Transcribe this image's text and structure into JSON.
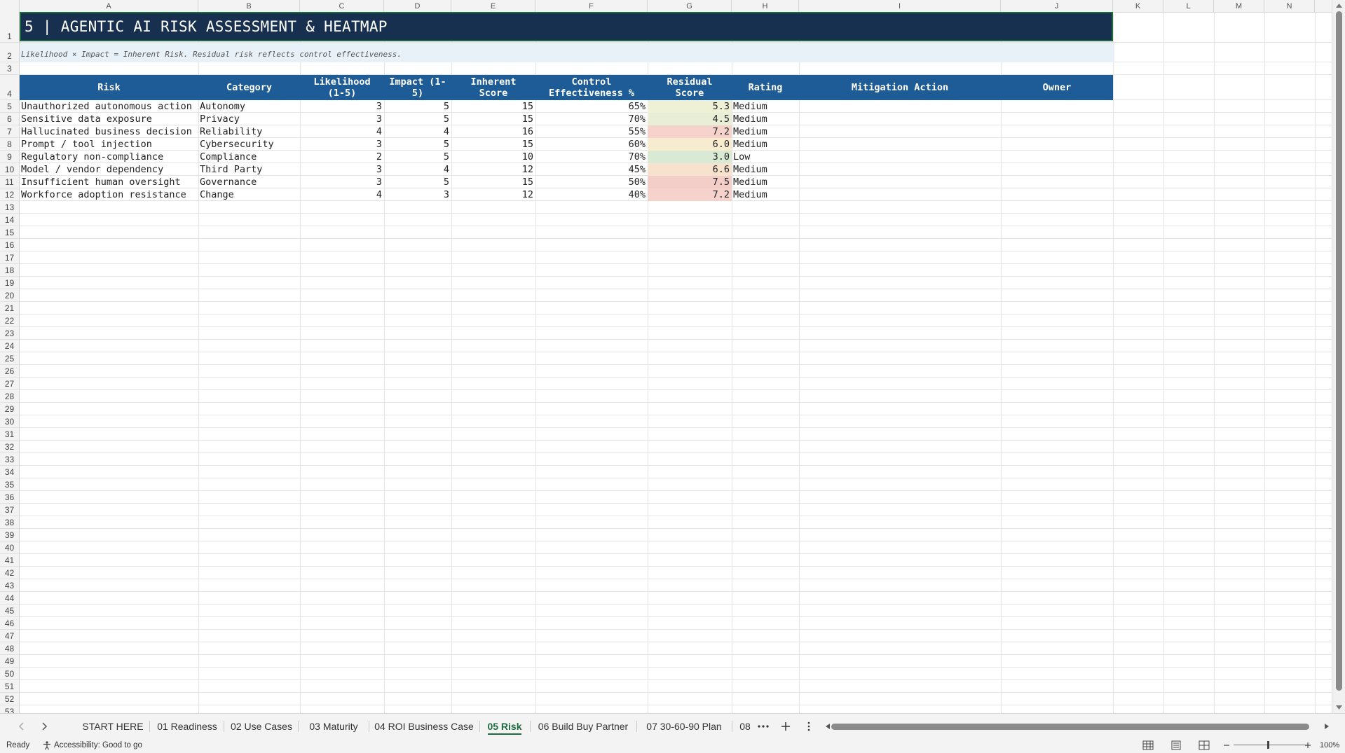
{
  "columns": [
    "A",
    "B",
    "C",
    "D",
    "E",
    "F",
    "G",
    "H",
    "I",
    "J",
    "K",
    "L",
    "M",
    "N"
  ],
  "row_numbers": [
    "1",
    "2",
    "3",
    "4",
    "5",
    "6",
    "7",
    "8",
    "9",
    "10",
    "11",
    "12",
    "13",
    "14",
    "15",
    "16",
    "17",
    "18",
    "19",
    "20",
    "21",
    "22",
    "23",
    "24",
    "25",
    "26",
    "27",
    "28",
    "29",
    "30",
    "31",
    "32",
    "33",
    "34",
    "35",
    "36",
    "37",
    "38",
    "39",
    "40",
    "41",
    "42",
    "43",
    "44",
    "45",
    "46",
    "47",
    "48",
    "49",
    "50",
    "51",
    "52",
    "53"
  ],
  "title": "5 | AGENTIC AI RISK ASSESSMENT & HEATMAP",
  "subtitle": "Likelihood × Impact = Inherent Risk. Residual risk reflects control effectiveness.",
  "headers": {
    "risk": "Risk",
    "category": "Category",
    "likelihood": "Likelihood\n(1-5)",
    "impact": "Impact (1-\n5)",
    "inherent": "Inherent\nScore",
    "control": "Control\nEffectiveness %",
    "residual": "Residual\nScore",
    "rating": "Rating",
    "mitigation": "Mitigation Action",
    "owner": "Owner"
  },
  "rows": [
    {
      "risk": "Unauthorized autonomous action",
      "category": "Autonomy",
      "likelihood": "3",
      "impact": "5",
      "inherent": "15",
      "control": "65%",
      "residual": "5.3",
      "rating": "Medium",
      "heat": "#eef1d6"
    },
    {
      "risk": "Sensitive data exposure",
      "category": "Privacy",
      "likelihood": "3",
      "impact": "5",
      "inherent": "15",
      "control": "70%",
      "residual": "4.5",
      "rating": "Medium",
      "heat": "#e8efd6"
    },
    {
      "risk": "Hallucinated business decision",
      "category": "Reliability",
      "likelihood": "4",
      "impact": "4",
      "inherent": "16",
      "control": "55%",
      "residual": "7.2",
      "rating": "Medium",
      "heat": "#f5d3cc"
    },
    {
      "risk": "Prompt / tool injection",
      "category": "Cybersecurity",
      "likelihood": "3",
      "impact": "5",
      "inherent": "15",
      "control": "60%",
      "residual": "6.0",
      "rating": "Medium",
      "heat": "#f8ecd0"
    },
    {
      "risk": "Regulatory non-compliance",
      "category": "Compliance",
      "likelihood": "2",
      "impact": "5",
      "inherent": "10",
      "control": "70%",
      "residual": "3.0",
      "rating": "Low",
      "heat": "#d8ead3"
    },
    {
      "risk": "Model / vendor dependency",
      "category": "Third Party",
      "likelihood": "3",
      "impact": "4",
      "inherent": "12",
      "control": "45%",
      "residual": "6.6",
      "rating": "Medium",
      "heat": "#f7e2cd"
    },
    {
      "risk": "Insufficient human oversight",
      "category": "Governance",
      "likelihood": "3",
      "impact": "5",
      "inherent": "15",
      "control": "50%",
      "residual": "7.5",
      "rating": "Medium",
      "heat": "#f3cdc8"
    },
    {
      "risk": "Workforce adoption resistance",
      "category": "Change",
      "likelihood": "4",
      "impact": "3",
      "inherent": "12",
      "control": "40%",
      "residual": "7.2",
      "rating": "Medium",
      "heat": "#f5d3cc"
    }
  ],
  "tabs": [
    "START HERE",
    "01 Readiness",
    "02 Use Cases",
    "03 Maturity",
    "04 ROI Business Case",
    "05 Risk",
    "06 Build Buy Partner",
    "07 30-60-90 Plan",
    "08"
  ],
  "active_tab": "05 Risk",
  "status": {
    "ready": "Ready",
    "accessibility": "Accessibility: Good to go",
    "zoom": "100%"
  },
  "colors": {
    "title_bg": "#17304f",
    "header_bg": "#1e5c97",
    "subtitle_bg": "#e9f1f8",
    "accent_green": "#1d6b3e"
  }
}
